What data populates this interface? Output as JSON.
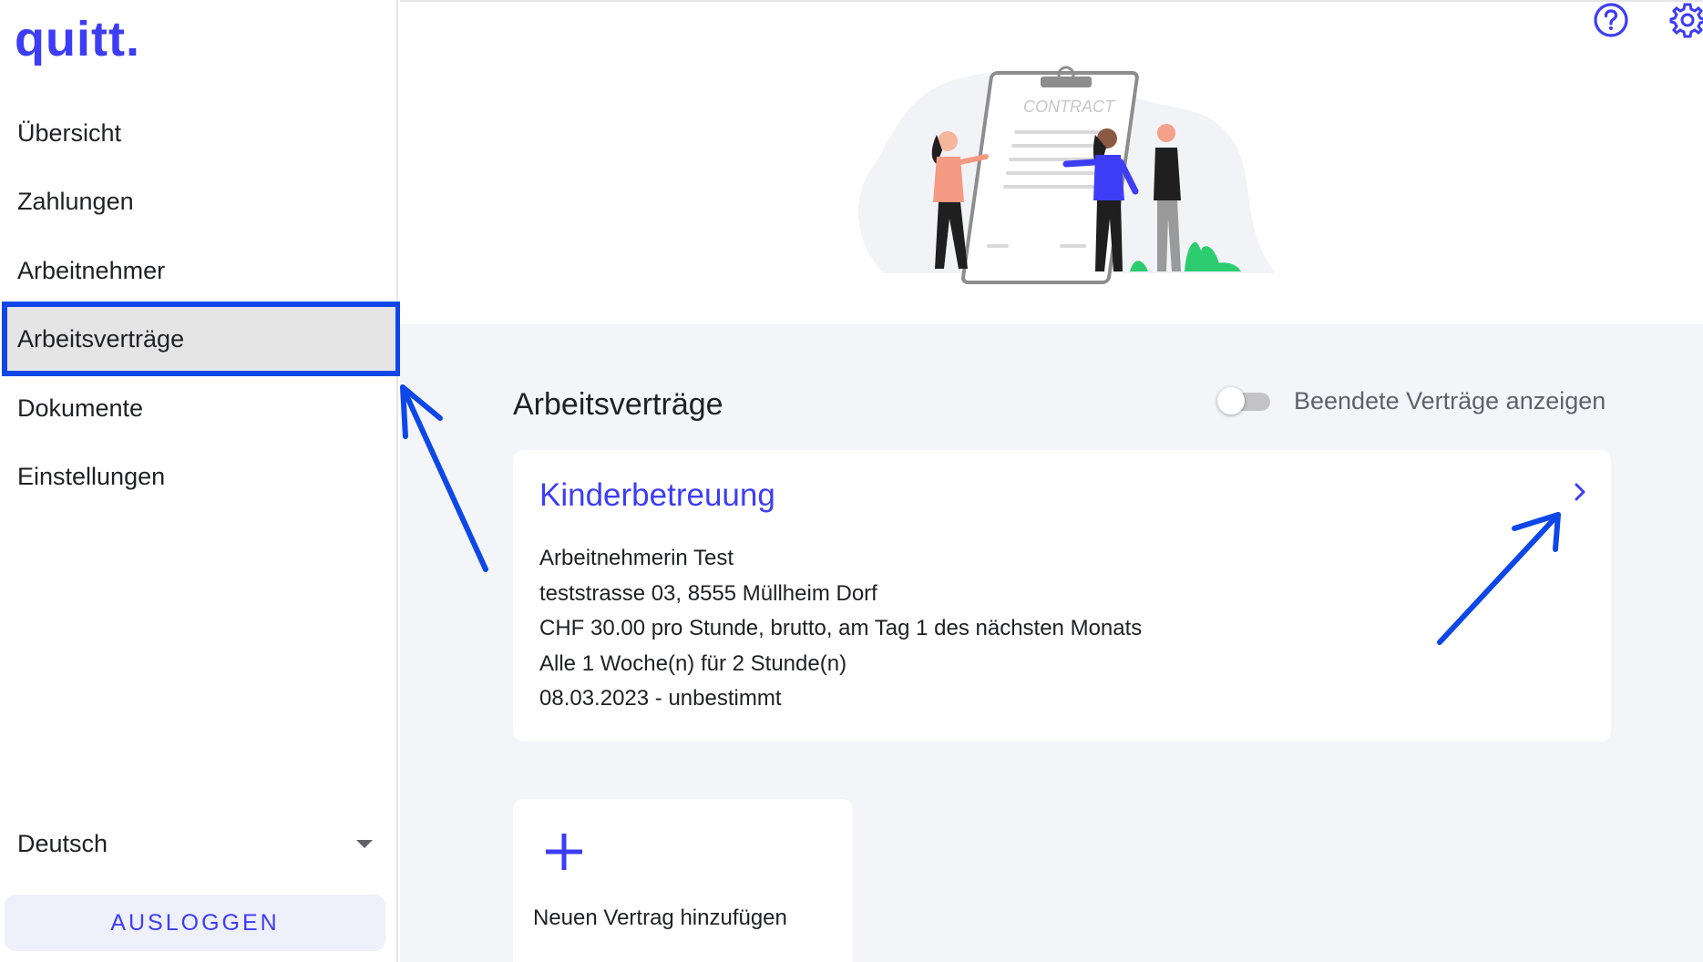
{
  "app": {
    "logo": "quitt."
  },
  "sidebar": {
    "items": [
      {
        "label": "Übersicht"
      },
      {
        "label": "Zahlungen"
      },
      {
        "label": "Arbeitnehmer"
      },
      {
        "label": "Arbeitsverträge",
        "active": true
      },
      {
        "label": "Dokumente"
      },
      {
        "label": "Einstellungen"
      }
    ],
    "language": "Deutsch",
    "logout_label": "AUSLOGGEN"
  },
  "header": {
    "icons": [
      "help-icon",
      "settings-gear-icon"
    ]
  },
  "hero": {
    "contract_text": "CONTRACT"
  },
  "main": {
    "title": "Arbeitsverträge",
    "toggle": {
      "label": "Beendete Verträge anzeigen",
      "checked": false
    },
    "contract": {
      "title": "Kinderbetreuung",
      "employee": "Arbeitnehmerin Test",
      "address": "teststrasse 03, 8555 Müllheim Dorf",
      "salary": "CHF 30.00 pro Stunde, brutto, am Tag 1 des nächsten Monats",
      "schedule": "Alle 1 Woche(n) für 2 Stunde(n)",
      "period": "08.03.2023 - unbestimmt"
    },
    "add_contract_label": "Neuen Vertrag hinzufügen"
  },
  "colors": {
    "accent": "#3d3df5",
    "annotation": "#0d47e8",
    "background": "#f4f5f9"
  }
}
